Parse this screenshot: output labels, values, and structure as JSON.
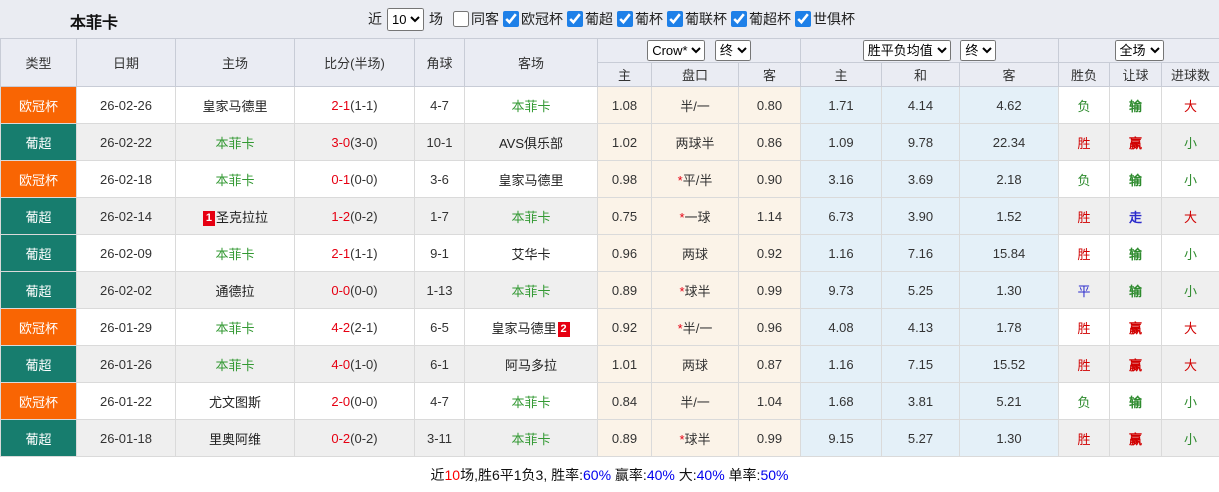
{
  "page": {
    "title": "本菲卡"
  },
  "filters": {
    "recent_label": "近",
    "recent_value": "10",
    "matches_label": "场",
    "same_opponent": {
      "label": "同客",
      "checked": false
    },
    "leagues": [
      {
        "label": "欧冠杯",
        "checked": true
      },
      {
        "label": "葡超",
        "checked": true
      },
      {
        "label": "葡杯",
        "checked": true
      },
      {
        "label": "葡联杯",
        "checked": true
      },
      {
        "label": "葡超杯",
        "checked": true
      },
      {
        "label": "世俱杯",
        "checked": true
      }
    ]
  },
  "table": {
    "header": {
      "cols": [
        "类型",
        "日期",
        "主场",
        "比分(半场)",
        "角球",
        "客场"
      ],
      "odds_source_select": "Crow*",
      "odds_time_select": "终",
      "mean_select": "胜平负均值",
      "mean_time_select": "终",
      "result_select": "全场",
      "sub_cols": [
        "主",
        "盘口",
        "客",
        "主",
        "和",
        "客",
        "胜负",
        "让球",
        "进球数"
      ]
    },
    "rows": [
      {
        "league": "欧冠杯",
        "date": "26-02-26",
        "home": {
          "name": "皇家马德里",
          "benfica": false
        },
        "score_ft": "2-1",
        "score_ht": "(1-1)",
        "corners": "4-7",
        "away": {
          "name": "本菲卡",
          "benfica": true
        },
        "odds": {
          "home": "1.08",
          "handicap": "半/一",
          "away": "0.80"
        },
        "mean": {
          "home": "1.71",
          "draw": "4.14",
          "away": "4.62"
        },
        "results": [
          {
            "text": "负",
            "color": "green"
          },
          {
            "text": "输",
            "color": "green"
          },
          {
            "text": "大",
            "color": "red"
          }
        ]
      },
      {
        "league": "葡超",
        "date": "26-02-22",
        "home": {
          "name": "本菲卡",
          "benfica": true
        },
        "score_ft": "3-0",
        "score_ht": "(3-0)",
        "corners": "10-1",
        "away": {
          "name": "AVS俱乐部",
          "benfica": false
        },
        "odds": {
          "home": "1.02",
          "handicap": "两球半",
          "away": "0.86"
        },
        "mean": {
          "home": "1.09",
          "draw": "9.78",
          "away": "22.34"
        },
        "results": [
          {
            "text": "胜",
            "color": "red"
          },
          {
            "text": "赢",
            "color": "red"
          },
          {
            "text": "小",
            "color": "green"
          }
        ]
      },
      {
        "league": "欧冠杯",
        "date": "26-02-18",
        "home": {
          "name": "本菲卡",
          "benfica": true
        },
        "score_ft": "0-1",
        "score_ht": "(0-0)",
        "corners": "3-6",
        "away": {
          "name": "皇家马德里",
          "benfica": false
        },
        "odds": {
          "home": "0.98",
          "handicap": "*平/半",
          "away": "0.90"
        },
        "mean": {
          "home": "3.16",
          "draw": "3.69",
          "away": "2.18"
        },
        "results": [
          {
            "text": "负",
            "color": "green"
          },
          {
            "text": "输",
            "color": "green"
          },
          {
            "text": "小",
            "color": "green"
          }
        ]
      },
      {
        "league": "葡超",
        "date": "26-02-14",
        "home": {
          "name": "圣克拉拉",
          "benfica": false,
          "badge": {
            "text": "1",
            "position": "before"
          }
        },
        "score_ft": "1-2",
        "score_ht": "(0-2)",
        "corners": "1-7",
        "away": {
          "name": "本菲卡",
          "benfica": true
        },
        "odds": {
          "home": "0.75",
          "handicap": "*一球",
          "away": "1.14"
        },
        "mean": {
          "home": "6.73",
          "draw": "3.90",
          "away": "1.52"
        },
        "results": [
          {
            "text": "胜",
            "color": "red"
          },
          {
            "text": "走",
            "color": "blue"
          },
          {
            "text": "大",
            "color": "red"
          }
        ]
      },
      {
        "league": "葡超",
        "date": "26-02-09",
        "home": {
          "name": "本菲卡",
          "benfica": true
        },
        "score_ft": "2-1",
        "score_ht": "(1-1)",
        "corners": "9-1",
        "away": {
          "name": "艾华卡",
          "benfica": false
        },
        "odds": {
          "home": "0.96",
          "handicap": "两球",
          "away": "0.92"
        },
        "mean": {
          "home": "1.16",
          "draw": "7.16",
          "away": "15.84"
        },
        "results": [
          {
            "text": "胜",
            "color": "red"
          },
          {
            "text": "输",
            "color": "green"
          },
          {
            "text": "小",
            "color": "green"
          }
        ]
      },
      {
        "league": "葡超",
        "date": "26-02-02",
        "home": {
          "name": "通德拉",
          "benfica": false
        },
        "score_ft": "0-0",
        "score_ht": "(0-0)",
        "corners": "1-13",
        "away": {
          "name": "本菲卡",
          "benfica": true
        },
        "odds": {
          "home": "0.89",
          "handicap": "*球半",
          "away": "0.99"
        },
        "mean": {
          "home": "9.73",
          "draw": "5.25",
          "away": "1.30"
        },
        "results": [
          {
            "text": "平",
            "color": "blue"
          },
          {
            "text": "输",
            "color": "green"
          },
          {
            "text": "小",
            "color": "green"
          }
        ]
      },
      {
        "league": "欧冠杯",
        "date": "26-01-29",
        "home": {
          "name": "本菲卡",
          "benfica": true
        },
        "score_ft": "4-2",
        "score_ht": "(2-1)",
        "corners": "6-5",
        "away": {
          "name": "皇家马德里",
          "benfica": false,
          "badge": {
            "text": "2",
            "position": "after"
          }
        },
        "odds": {
          "home": "0.92",
          "handicap": "*半/一",
          "away": "0.96"
        },
        "mean": {
          "home": "4.08",
          "draw": "4.13",
          "away": "1.78"
        },
        "results": [
          {
            "text": "胜",
            "color": "red"
          },
          {
            "text": "赢",
            "color": "red"
          },
          {
            "text": "大",
            "color": "red"
          }
        ]
      },
      {
        "league": "葡超",
        "date": "26-01-26",
        "home": {
          "name": "本菲卡",
          "benfica": true
        },
        "score_ft": "4-0",
        "score_ht": "(1-0)",
        "corners": "6-1",
        "away": {
          "name": "阿马多拉",
          "benfica": false
        },
        "odds": {
          "home": "1.01",
          "handicap": "两球",
          "away": "0.87"
        },
        "mean": {
          "home": "1.16",
          "draw": "7.15",
          "away": "15.52"
        },
        "results": [
          {
            "text": "胜",
            "color": "red"
          },
          {
            "text": "赢",
            "color": "red"
          },
          {
            "text": "大",
            "color": "red"
          }
        ]
      },
      {
        "league": "欧冠杯",
        "date": "26-01-22",
        "home": {
          "name": "尤文图斯",
          "benfica": false
        },
        "score_ft": "2-0",
        "score_ht": "(0-0)",
        "corners": "4-7",
        "away": {
          "name": "本菲卡",
          "benfica": true
        },
        "odds": {
          "home": "0.84",
          "handicap": "半/一",
          "away": "1.04"
        },
        "mean": {
          "home": "1.68",
          "draw": "3.81",
          "away": "5.21"
        },
        "results": [
          {
            "text": "负",
            "color": "green"
          },
          {
            "text": "输",
            "color": "green"
          },
          {
            "text": "小",
            "color": "green"
          }
        ]
      },
      {
        "league": "葡超",
        "date": "26-01-18",
        "home": {
          "name": "里奥阿维",
          "benfica": false
        },
        "score_ft": "0-2",
        "score_ht": "(0-2)",
        "corners": "3-11",
        "away": {
          "name": "本菲卡",
          "benfica": true
        },
        "odds": {
          "home": "0.89",
          "handicap": "*球半",
          "away": "0.99"
        },
        "mean": {
          "home": "9.15",
          "draw": "5.27",
          "away": "1.30"
        },
        "results": [
          {
            "text": "胜",
            "color": "red"
          },
          {
            "text": "赢",
            "color": "red"
          },
          {
            "text": "小",
            "color": "green"
          }
        ]
      }
    ]
  },
  "footer": {
    "segments": [
      {
        "text": "近",
        "color": "black"
      },
      {
        "text": "10",
        "color": "red"
      },
      {
        "text": "场,胜6平1负3, 胜率:",
        "color": "black"
      },
      {
        "text": "60%",
        "color": "blue"
      },
      {
        "text": " 赢率:",
        "color": "black"
      },
      {
        "text": "40%",
        "color": "blue"
      },
      {
        "text": " 大:",
        "color": "black"
      },
      {
        "text": "40%",
        "color": "blue"
      },
      {
        "text": " 单率:",
        "color": "black"
      },
      {
        "text": "50%",
        "color": "blue"
      }
    ]
  },
  "colors": {
    "ucl_orange": "#F96503",
    "primeira_teal": "#177D6E",
    "benfica_green": "#339933",
    "score_red": "#E60012",
    "result_red": "#D10000",
    "result_green": "#2E8B2E",
    "result_blue": "#2B2BCC",
    "odds_bg": "#FBF3E8",
    "mean_bg": "#E4F0F8",
    "header_bg": "#EAECF3",
    "topbar_bg": "#EAECF2",
    "alt_row_bg": "#EFEFEF",
    "checkbox_blue": "#1E80E8",
    "footer_blue": "#0000EE",
    "footer_red": "#FF0000"
  }
}
